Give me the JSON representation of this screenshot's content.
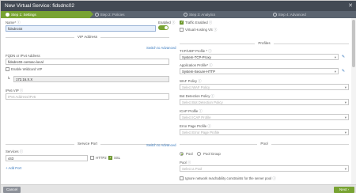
{
  "dialog": {
    "title": "New Virtual Service: fidsdnc02"
  },
  "wizard": {
    "steps": [
      "Step 1: Settings",
      "Step 2: Policies",
      "Step 3: Analytics",
      "Step 4: Advanced"
    ]
  },
  "left": {
    "name_label": "Name*",
    "name_value": "fidsdnc02",
    "enabled_label": "Enabled",
    "vip_section": "VIP Address",
    "switch_advanced": "Switch to Advanced",
    "fqdn_label": "FQDN or IPv4 Address",
    "fqdn_value": "fidsdnc02.contoso.local",
    "wildcard_label": "Enable Wildcard VIP",
    "ip_value": "172.16.X.X",
    "ipv6_label": "IPv6 VIP",
    "ipv6_placeholder": "IPv6 Address/IPv6",
    "service_port_section": "Service Port",
    "switch_advanced_2": "Switch to Advanced",
    "services_label": "Services",
    "services_value": "443",
    "http2_label": "HTTP2",
    "ssl_label": "SSL",
    "add_port": "+ Add Port"
  },
  "right": {
    "traffic_enabled": "Traffic Enabled",
    "virtual_hosting": "Virtual Hosting VS",
    "profiles_section": "Profiles",
    "tcp_label": "TCP/UDP Profile *",
    "tcp_value": "System-TCP-Proxy",
    "app_label": "Application Profile*",
    "app_value": "System-Secure-HTTP",
    "waf_label": "WAF Policy",
    "waf_placeholder": "Select WAF Policy",
    "bot_label": "Bot Detection Policy",
    "bot_placeholder": "Select Bot Detection Policy",
    "icap_label": "ICAP Profile",
    "icap_placeholder": "Select ICAP Profile",
    "err_label": "Error Page Profile",
    "err_placeholder": "Select Error Page Profile",
    "pool_section": "Pool",
    "pool_option": "Pool",
    "pool_group_option": "Pool Group",
    "pool_label": "Pool",
    "pool_placeholder": "Select a Pool",
    "ignore_label": "Ignore network reachability constraints for the server pool"
  },
  "footer": {
    "cancel": "Cancel",
    "next": "Next"
  },
  "icons": {
    "info": "ⓘ",
    "edit": "✎",
    "close": "✕",
    "arrow": "↳"
  },
  "colors": {
    "accent": "#78a332",
    "titlebar": "#434a54",
    "link": "#3b7bbf"
  }
}
